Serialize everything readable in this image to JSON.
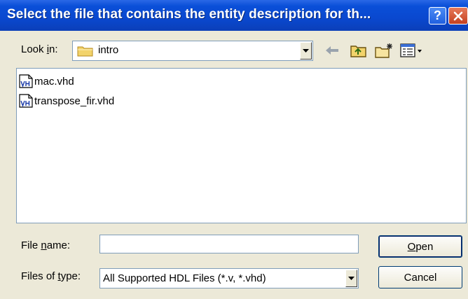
{
  "dialog": {
    "title": "Select the file that contains the entity description for th...",
    "help_glyph": "?",
    "close_glyph": "✕"
  },
  "lookin": {
    "label_pre": "Look ",
    "label_acc": "i",
    "label_post": "n:",
    "value": "intro",
    "icon": "folder-icon"
  },
  "toolbar": {
    "icons": [
      "back-arrow-icon",
      "up-one-level-icon",
      "create-new-folder-icon",
      "view-menu-icon"
    ]
  },
  "files": [
    {
      "name": "mac.vhd",
      "icon": "vhd-file-icon"
    },
    {
      "name": "transpose_fir.vhd",
      "icon": "vhd-file-icon"
    }
  ],
  "filename": {
    "label_pre": "File ",
    "label_acc": "n",
    "label_post": "ame:",
    "value": ""
  },
  "filetype": {
    "label_pre": "Files of ",
    "label_acc": "t",
    "label_post": "ype:",
    "value": "All Supported HDL Files  (*.v, *.vhd)"
  },
  "buttons": {
    "open_acc": "O",
    "open_rest": "pen",
    "cancel": "Cancel"
  },
  "colors": {
    "titlebar": "#0a48cf",
    "dialog_bg": "#ece9d8",
    "field_border": "#7f9db9"
  }
}
